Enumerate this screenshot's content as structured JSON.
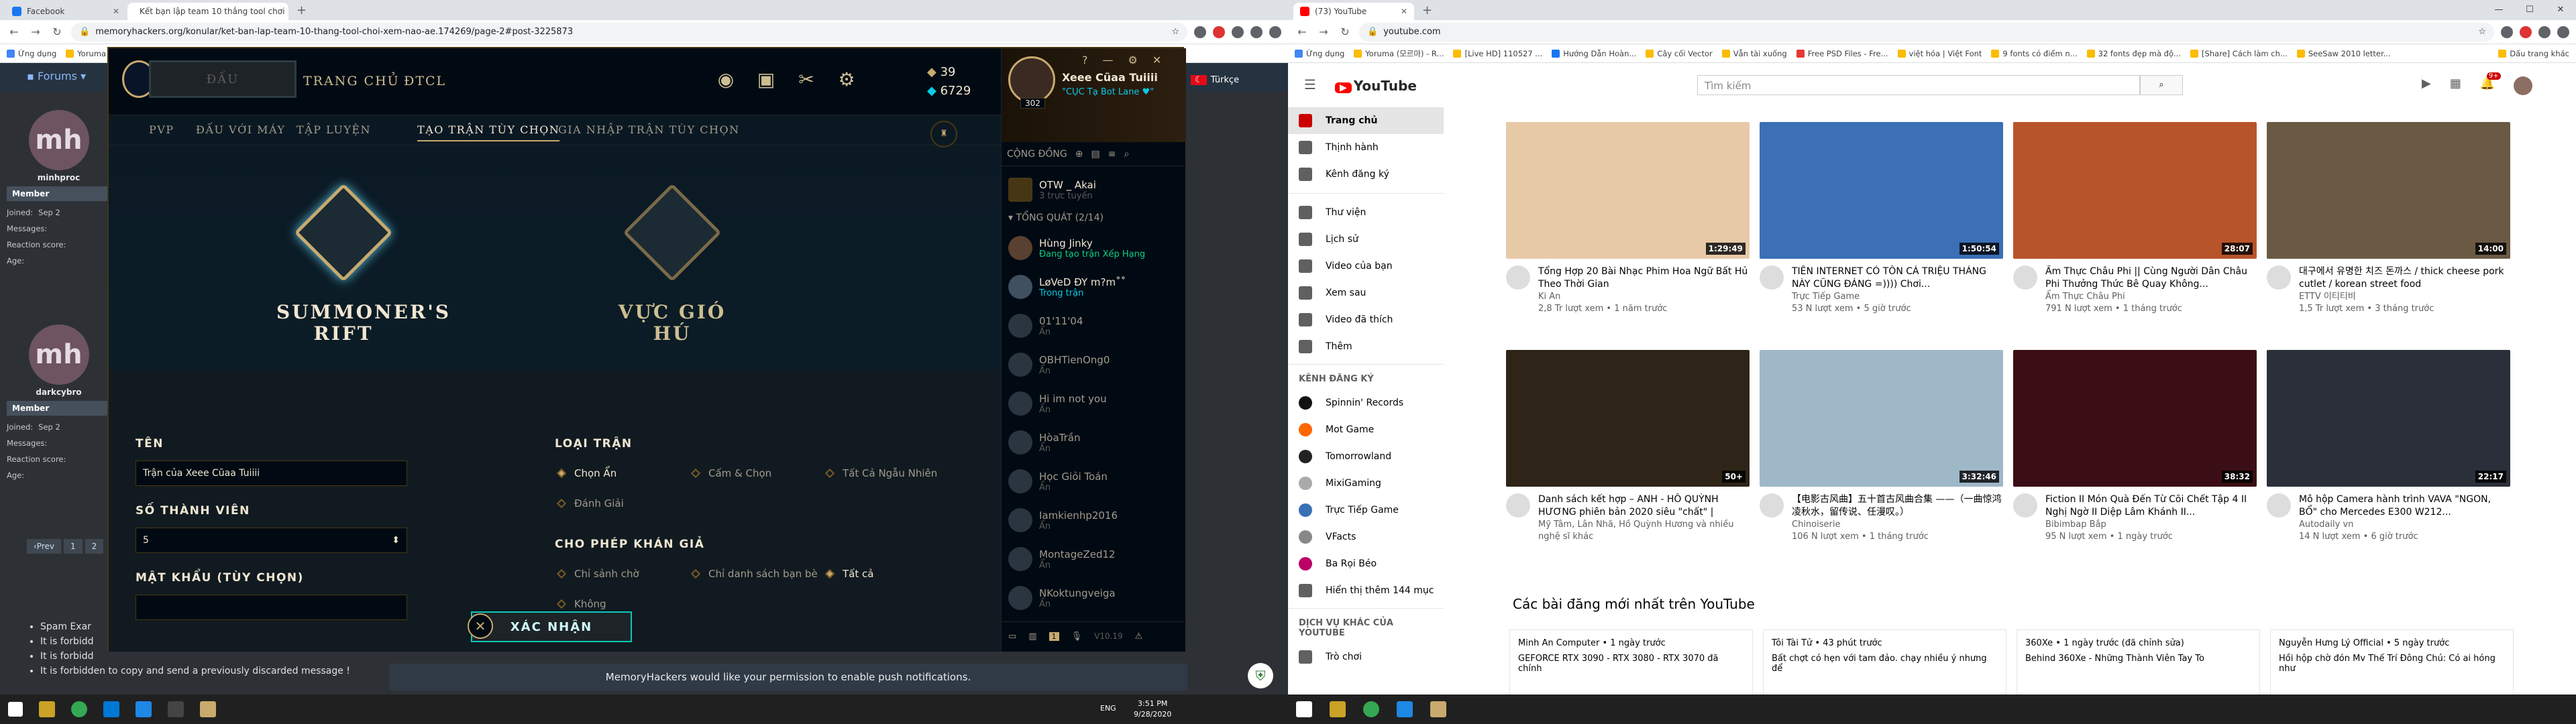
{
  "left_browser": {
    "tabs": [
      {
        "title": "Facebook",
        "active": false
      },
      {
        "title": "Kết bạn lập team 10 thắng tool chơi",
        "active": true
      }
    ],
    "url": "memoryhackers.org/konular/ket-ban-lap-team-10-thang-tool-choi-xem-nao-ae.174269/page-2#post-3225873",
    "bookmarks": [
      "Ứng dụng",
      "Yoruma"
    ]
  },
  "right_browser": {
    "tabs": [
      {
        "title": "(73) YouTube",
        "active": true
      }
    ],
    "url": "youtube.com",
    "bookmarks": [
      "Ứng dụng",
      "Yoruma (모르마) - R...",
      "[Live HD] 110527 ...",
      "Hướng Dẫn Hoàn...",
      "Cây cối Vector",
      "Vẫn tài xuống",
      "Free PSD Files - Fre...",
      "việt hóa | Việt Font",
      "9 fonts có điểm n...",
      "32 fonts đẹp mà độ...",
      "[Share] Cách làm ch...",
      "SeeSaw 2010 letter..."
    ],
    "bookmark_right": "Dấu trang khác"
  },
  "forum": {
    "nav_label": "Forums",
    "users": [
      {
        "name": "minhproc",
        "initials": "mh",
        "role": "Member",
        "joined_label": "Joined:",
        "joined": "Sep 2",
        "messages_label": "Messages:",
        "reaction_label": "Reaction score:",
        "age_label": "Age:"
      },
      {
        "name": "darkcybro",
        "initials": "mh",
        "role": "Member",
        "joined_label": "Joined:",
        "joined": "Sep 2",
        "messages_label": "Messages:",
        "reaction_label": "Reaction score:",
        "age_label": "Age:"
      }
    ],
    "pager": [
      "‹Prev",
      "1",
      "2"
    ],
    "rules": [
      "Spam Exar",
      "It is forbidd",
      "It is forbidd",
      "It is forbidden to copy and send a previously discarded message !"
    ],
    "notification": "MemoryHackers would like your permission to enable push notifications.",
    "language": "Türkçe"
  },
  "lol": {
    "play_label": "ĐẤU",
    "nav": [
      "TRANG CHỦ",
      "ĐTCL"
    ],
    "currency": {
      "be": "39",
      "rp": "6729"
    },
    "subnav": [
      {
        "label": "PVP",
        "active": false
      },
      {
        "label": "ĐẤU VỚI MÁY",
        "active": false
      },
      {
        "label": "TẬP LUYỆN",
        "active": false
      },
      {
        "label": "TẠO TRẬN TÙY CHỌN",
        "active": true
      },
      {
        "label": "GIA NHẬP TRẬN TÙY CHỌN",
        "active": false
      }
    ],
    "maps": [
      {
        "name": "SUMMONER'S\nRIFT"
      },
      {
        "name": "VỰC GIÓ HÚ"
      }
    ],
    "form": {
      "name_label": "TÊN",
      "name_value": "Trận của Xeee Cũaa Tuiiii",
      "members_label": "SỐ THÀNH VIÊN",
      "members_value": "5",
      "password_label": "MẬT KHẨU (TÙY CHỌN)",
      "type_label": "LOẠI TRẬN",
      "types": [
        {
          "label": "Chọn Ẩn",
          "selected": true
        },
        {
          "label": "Cấm & Chọn",
          "selected": false
        },
        {
          "label": "Tất Cả Ngẫu Nhiên",
          "selected": false
        },
        {
          "label": "Đánh Giải",
          "selected": false
        }
      ],
      "spectator_label": "CHO PHÉP KHÁN GIẢ",
      "spectators": [
        {
          "label": "Chỉ sảnh chờ",
          "selected": false
        },
        {
          "label": "Chỉ danh sách bạn bè",
          "selected": false
        },
        {
          "label": "Tất cả",
          "selected": true
        },
        {
          "label": "Không",
          "selected": false
        }
      ],
      "confirm_label": "XÁC NHẬN"
    },
    "profile": {
      "name": "Xeee Cũaa Tuiiii",
      "status": "\"CỤC Tạ Bot Lane ♥\"",
      "level": "302"
    },
    "social": {
      "header": "CỘNG ĐỒNG",
      "featured": {
        "name": "OTW _ Akai",
        "status": "3 trực tuyến"
      },
      "group_label": "TỔNG QUÁT (2/14)",
      "friends": [
        {
          "name": "Hùng Jinky",
          "status": "Đang tạo trận Xếp Hạng",
          "online": true
        },
        {
          "name": "LøVeD ÐY m?m˚˚",
          "status": "Trong trận",
          "online": true
        },
        {
          "name": "01'11'04",
          "status": "Ẩn",
          "online": false
        },
        {
          "name": "OBHTienOng0",
          "status": "Ẩn",
          "online": false
        },
        {
          "name": "Hi im not you",
          "status": "Ẩn",
          "online": false
        },
        {
          "name": "HòaTrần",
          "status": "Ẩn",
          "online": false
        },
        {
          "name": "Học Giỏi Toán",
          "status": "Ẩn",
          "online": false
        },
        {
          "name": "Iamkienhp2016",
          "status": "Ẩn",
          "online": false
        },
        {
          "name": "MontageZed12",
          "status": "Ẩn",
          "online": false
        },
        {
          "name": "NKoktungveiga",
          "status": "Ẩn",
          "online": false
        }
      ],
      "version": "V10.19",
      "chat_count": "1"
    }
  },
  "youtube": {
    "search_placeholder": "Tìm kiếm",
    "notif_count": "9+",
    "sidebar_main": [
      {
        "label": "Trang chủ",
        "active": true
      },
      {
        "label": "Thịnh hành",
        "active": false
      },
      {
        "label": "Kênh đăng ký",
        "active": false
      }
    ],
    "sidebar_lib": [
      "Thư viện",
      "Lịch sử",
      "Video của bạn",
      "Xem sau",
      "Video đã thích",
      "Thêm"
    ],
    "subs_label": "KÊNH ĐĂNG KÝ",
    "subs": [
      "Spinnin' Records",
      "Mot Game",
      "Tomorrowland",
      "MixiGaming",
      "Trực Tiếp Game",
      "VFacts",
      "Ba Rọi Béo",
      "Hiển thị thêm 144 mục"
    ],
    "more_label": "DỊCH VỤ KHÁC CỦA YOUTUBE",
    "more_items": [
      "Trò chơi"
    ],
    "videos": [
      {
        "title": "Tổng Hợp 20 Bài Nhạc Phim Hoa Ngữ Bất Hủ Theo Thời Gian",
        "channel": "Ki An",
        "meta": "2,8 Tr lượt xem • 1 năm trước",
        "duration": "1:29:49",
        "color": "#e7c9a8"
      },
      {
        "title": "TIỀN INTERNET CÓ TỒN CÁ TRIỆU THÁNG NÀY CŨNG ĐÁNG =)))) Chơi...",
        "channel": "Trực Tiếp Game",
        "meta": "53 N lượt xem • 5 giờ trước",
        "duration": "1:50:54",
        "color": "#3b6fb6"
      },
      {
        "title": "Ẩm Thực Châu Phi || Cùng Người Dân Châu Phi Thưởng Thức Bê Quay Không...",
        "channel": "Ẩm Thực Châu Phi",
        "meta": "791 N lượt xem • 1 tháng trước",
        "duration": "28:07",
        "color": "#b8542a"
      },
      {
        "title": "대구에서 유명한 치즈 돈까스 / thick cheese pork cutlet / korean street food",
        "channel": "ETTV 이티티비",
        "meta": "1,5 Tr lượt xem • 3 tháng trước",
        "duration": "14:00",
        "color": "#6b5a43"
      },
      {
        "title": "Danh sách kết hợp – ANH - HỒ QUỲNH HƯƠNG phiên bản 2020 siêu \"chất\" | MUSIC...",
        "channel": "Mỹ Tâm, Lân Nhã, Hồ Quỳnh Hương và nhiều nghệ sĩ khác",
        "meta": "",
        "duration": "50+",
        "color": "#2e2418"
      },
      {
        "title": "【电影古风曲】五十首古风曲合集 ——（一曲惊鸿凌秋水，留传说、任漫叹。）",
        "channel": "Chinoiserie",
        "meta": "106 N lượt xem • 1 tháng trước",
        "duration": "3:32:46",
        "color": "#9fb8c8"
      },
      {
        "title": "Fiction II Món Quà Đến Từ Cõi Chết Tập 4 II Nghị Ngờ II Diệp Lâm Khánh II...",
        "channel": "Bibimbap Bắp",
        "meta": "95 N lượt xem • 1 ngày trước",
        "duration": "38:32",
        "color": "#3a0e14"
      },
      {
        "title": "Mô hộp Camera hành trình VAVA \"NGON, BỔ\" cho Mercedes E300 W212...",
        "channel": "Autodaily vn",
        "meta": "14 N lượt xem • 6 giờ trước",
        "duration": "22:17",
        "color": "#2a2f3a"
      }
    ],
    "section_title": "Các bài đăng mới nhất trên YouTube",
    "posts": [
      {
        "channel": "Minh An Computer",
        "meta": "1 ngày trước",
        "text": "GEFORCE RTX 3090 - RTX 3080 - RTX 3070 đã chính"
      },
      {
        "channel": "Tôi Tài Tử",
        "meta": "43 phút trước",
        "text": "Bất chợt có hẹn với tam đảo. chạy nhiều ý nhưng để"
      },
      {
        "channel": "360Xe",
        "meta": "1 ngày trước (đã chỉnh sửa)",
        "text": "Behind 360Xe - Những Thành Viên Tay To"
      },
      {
        "channel": "Nguyễn Hưng Lý Official",
        "meta": "5 ngày trước",
        "text": "Hồi hộp chờ đón Mv Thế Trí Đông Chú: Có ai hóng như"
      }
    ]
  },
  "taskbar": {
    "time": "3:51 PM",
    "date": "9/28/2020",
    "lang": "ENG"
  }
}
